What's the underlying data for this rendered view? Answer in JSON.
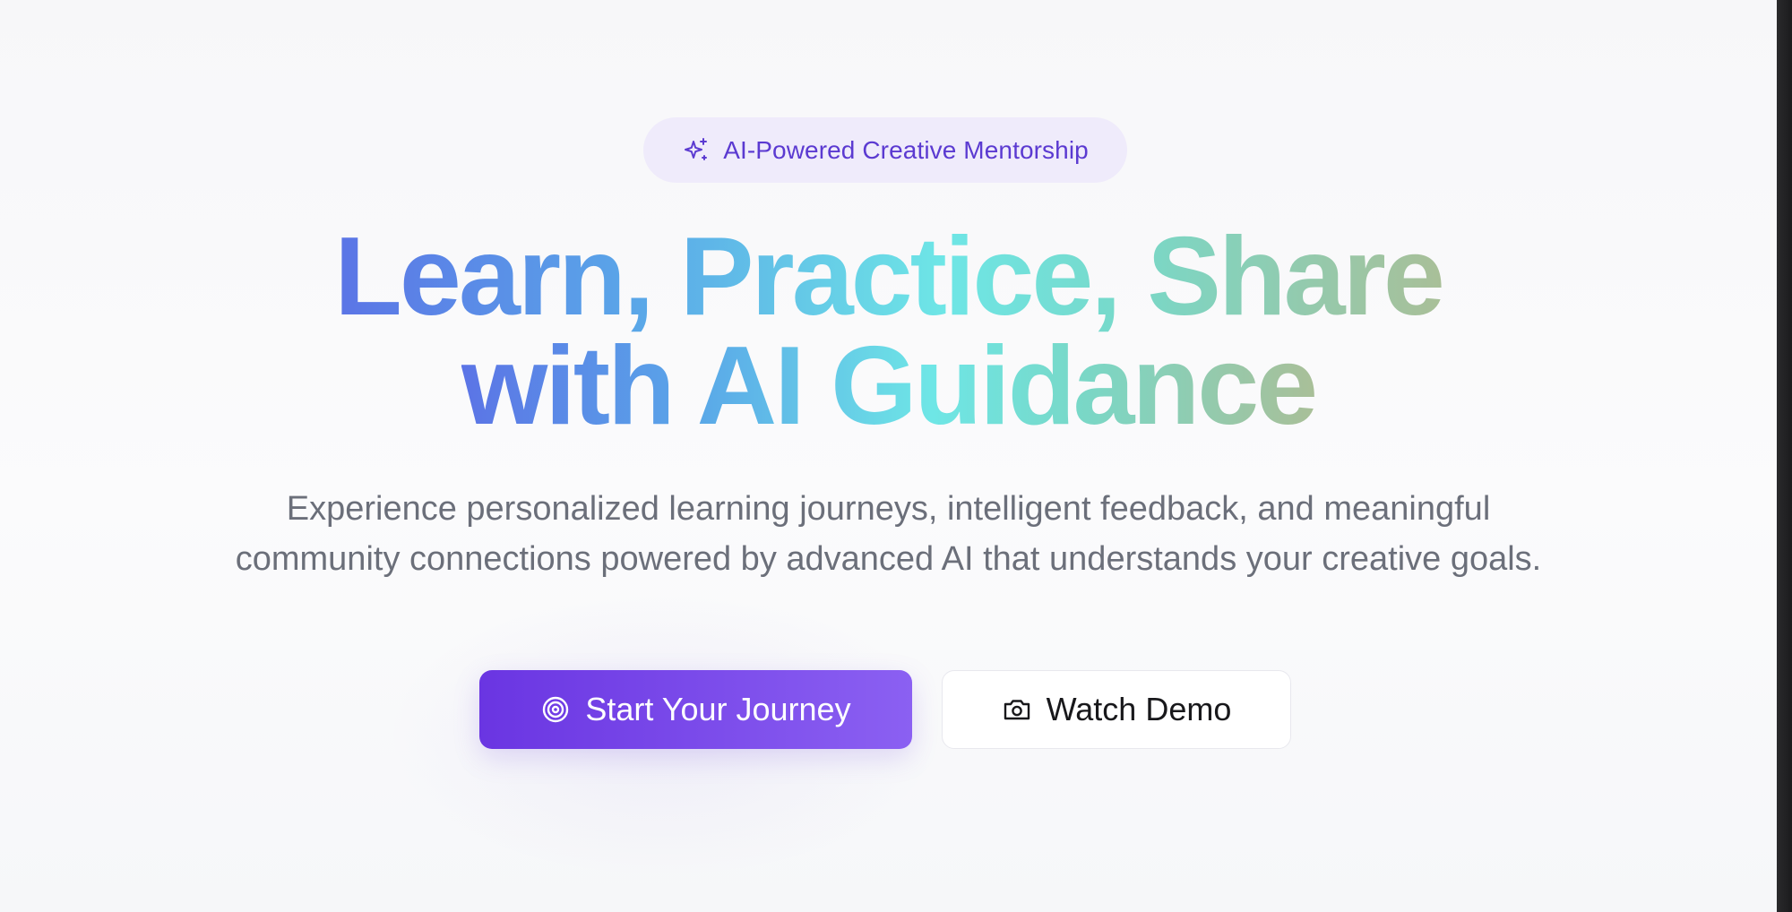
{
  "hero": {
    "badge": {
      "icon": "sparkles-icon",
      "label": "AI-Powered Creative Mentorship"
    },
    "headline": {
      "line1": "Learn, Practice, Share",
      "line2": "with AI Guidance"
    },
    "subtitle": {
      "line1": "Experience personalized learning journeys, intelligent feedback, and meaningful",
      "line2": "community connections powered by advanced AI that understands your creative goals."
    },
    "primary_button": {
      "icon": "target-icon",
      "label": "Start Your Journey"
    },
    "secondary_button": {
      "icon": "camera-icon",
      "label": "Watch Demo"
    }
  },
  "colors": {
    "accent": "#6a35e2",
    "badge_bg": "#efebfb",
    "badge_text": "#5b3ad1",
    "headline_gradient": [
      "#5b74e6",
      "#5aa8e8",
      "#6ee6e6",
      "#78d8c8",
      "#a9bf98"
    ],
    "body_text": "#6b6f7a"
  }
}
